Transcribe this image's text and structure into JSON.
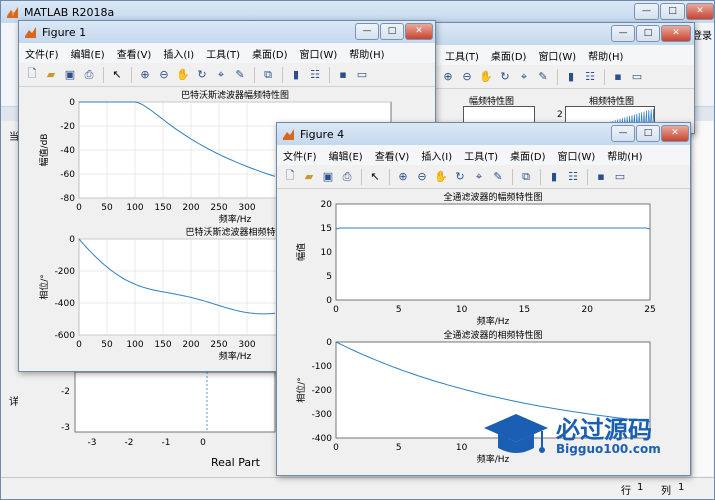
{
  "main": {
    "title": "MATLAB R2018a",
    "right_text": "登录",
    "status_row_label": "行",
    "status_row": "1",
    "status_col_label": "列",
    "status_col": "1",
    "left_letters": [
      "当",
      "详"
    ]
  },
  "fig1": {
    "title": "Figure 1",
    "menu": [
      "文件(F)",
      "编辑(E)",
      "查看(V)",
      "插入(I)",
      "工具(T)",
      "桌面(D)",
      "窗口(W)",
      "帮助(H)"
    ],
    "plot1": {
      "title": "巴特沃斯滤波器幅频特性图",
      "xlabel": "频率/Hz",
      "ylabel": "幅值/dB",
      "xticks": [
        "0",
        "50",
        "100",
        "150",
        "200",
        "250",
        "300"
      ],
      "yticks": [
        "0",
        "-20",
        "-40",
        "-60",
        "-80"
      ]
    },
    "plot2": {
      "title": "巴特沃斯滤波器相频特性",
      "xlabel": "频率/Hz",
      "ylabel": "相位/°",
      "xticks": [
        "0",
        "50",
        "100",
        "150",
        "200",
        "250",
        "300"
      ],
      "yticks": [
        "0",
        "-200",
        "-400",
        "-600"
      ]
    }
  },
  "fig3": {
    "menu": [
      "工具(T)",
      "桌面(D)",
      "窗口(W)",
      "帮助(H)"
    ],
    "title_a": "幅频特性图",
    "title_b": "相频特性图",
    "ytick_b": "2"
  },
  "bottomplot": {
    "xlabel": "Real Part",
    "xticks": [
      "-3",
      "-2",
      "-1",
      "0"
    ],
    "yticks": [
      "-2",
      "-3"
    ]
  },
  "fig4": {
    "title": "Figure 4",
    "menu": [
      "文件(F)",
      "编辑(E)",
      "查看(V)",
      "插入(I)",
      "工具(T)",
      "桌面(D)",
      "窗口(W)",
      "帮助(H)"
    ],
    "plot1": {
      "title": "全通滤波器的幅频特性图",
      "xlabel": "频率/Hz",
      "ylabel": "幅值",
      "xticks": [
        "0",
        "5",
        "10",
        "15",
        "20",
        "25"
      ],
      "yticks": [
        "20",
        "15",
        "10",
        "5",
        "0"
      ]
    },
    "plot2": {
      "title": "全通滤波器的相频特性图",
      "xlabel": "频率/Hz",
      "ylabel": "相位/°",
      "xticks": [
        "0",
        "5",
        "10",
        "15"
      ],
      "yticks": [
        "0",
        "-100",
        "-200",
        "-300",
        "-400"
      ]
    }
  },
  "watermark": {
    "text": "必过源码",
    "url": "Bigguo100.com"
  },
  "colors": {
    "line": "#2f7fc4",
    "watermark": "#1a5fb4"
  }
}
